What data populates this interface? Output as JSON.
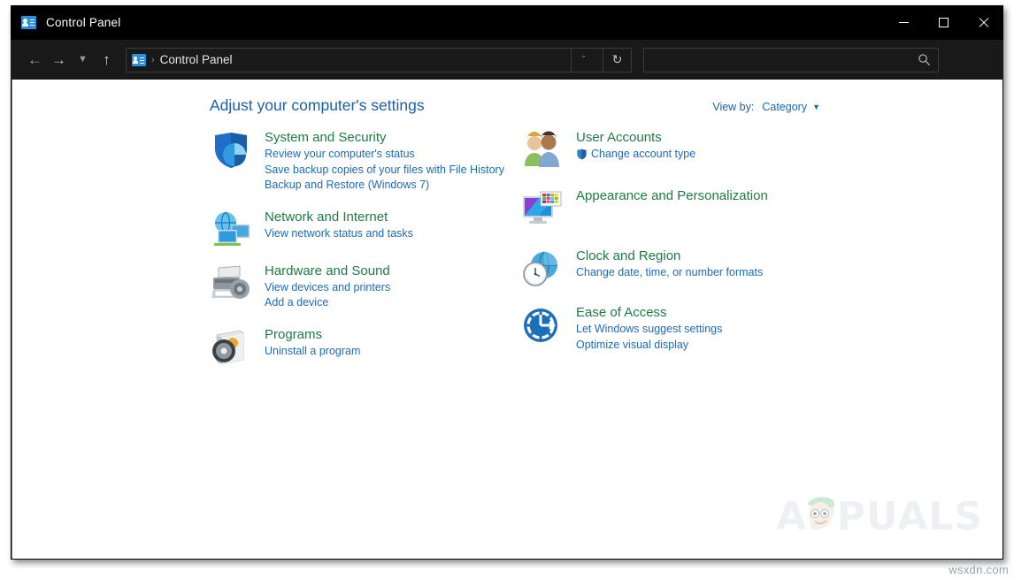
{
  "window": {
    "title": "Control Panel",
    "title_icon": "control-panel-icon",
    "controls": {
      "minimize": "Minimize",
      "maximize": "Maximize",
      "close": "Close"
    }
  },
  "navbar": {
    "back": "Back",
    "forward": "Forward",
    "recent": "Recent locations",
    "up": "Up one level",
    "breadcrumb": {
      "icon": "control-panel-icon",
      "separator": "›",
      "label": "Control Panel"
    },
    "dropdown": "ˇ",
    "refresh": "↻",
    "search": {
      "value": "",
      "placeholder": ""
    }
  },
  "main": {
    "page_title": "Adjust your computer's settings",
    "view_by": {
      "label": "View by:",
      "value": "Category",
      "caret": "▼"
    }
  },
  "categories_left": [
    {
      "icon": "shield-icon",
      "title": "System and Security",
      "links": [
        "Review your computer's status",
        "Save backup copies of your files with File History",
        "Backup and Restore (Windows 7)"
      ]
    },
    {
      "icon": "network-globe-monitors-icon",
      "title": "Network and Internet",
      "links": [
        "View network status and tasks"
      ]
    },
    {
      "icon": "printer-speaker-icon",
      "title": "Hardware and Sound",
      "links": [
        "View devices and printers",
        "Add a device"
      ]
    },
    {
      "icon": "programs-disc-box-icon",
      "title": "Programs",
      "links": [
        "Uninstall a program"
      ]
    }
  ],
  "categories_right": [
    {
      "icon": "user-accounts-people-icon",
      "title": "User Accounts",
      "links": [
        "Change account type"
      ],
      "shield_on_first_link": true
    },
    {
      "icon": "monitor-palette-icon",
      "title": "Appearance and Personalization",
      "links": []
    },
    {
      "icon": "clock-globe-icon",
      "title": "Clock and Region",
      "links": [
        "Change date, time, or number formats"
      ]
    },
    {
      "icon": "ease-of-access-wheel-icon",
      "title": "Ease of Access",
      "links": [
        "Let Windows suggest settings",
        "Optimize visual display"
      ]
    }
  ],
  "watermark": {
    "brand": "APPUALS",
    "site": "wsxdn.com"
  },
  "colors": {
    "titlebar_bg": "#000000",
    "navbar_bg": "#191919",
    "content_bg": "#ffffff",
    "heading_blue": "#1d5fa8",
    "category_green": "#1d7b45",
    "link_blue": "#1d6bb5"
  }
}
